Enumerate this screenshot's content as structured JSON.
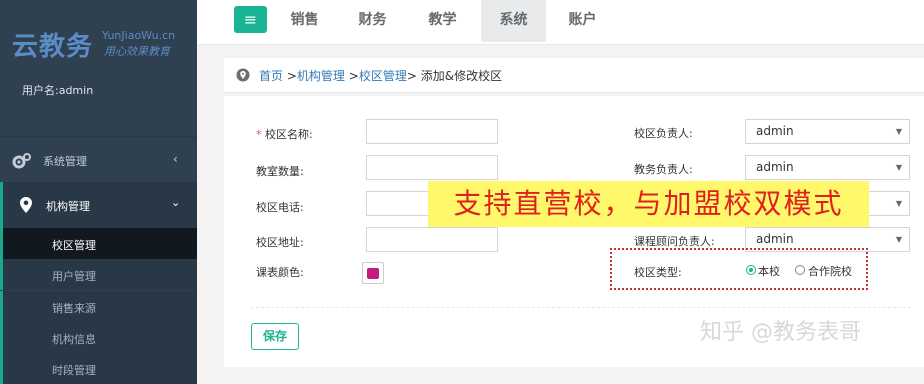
{
  "brand": {
    "name_cn": "云教务",
    "name_en": "YunJiaoWu.cn",
    "slogan": "用心效果教育"
  },
  "user": {
    "label": "用户名:admin"
  },
  "sidebar": {
    "system": {
      "label": "系统管理",
      "icon": "gears-icon"
    },
    "org": {
      "label": "机构管理",
      "icon": "map-marker-icon"
    },
    "sub_items": [
      "校区管理",
      "用户管理",
      "销售来源",
      "机构信息",
      "时段管理"
    ],
    "active_index": 0
  },
  "topnav": {
    "menu_glyph": "≡",
    "tabs": [
      "销售",
      "财务",
      "教学",
      "系统",
      "账户"
    ],
    "active_tab": "系统"
  },
  "breadcrumb": {
    "home": "首页",
    "level1": "机构管理",
    "level2": "校区管理",
    "current": "添加&修改校区",
    "sep": ">"
  },
  "form": {
    "left": {
      "name_label": "校区名称:",
      "classrooms_label": "教室数量:",
      "phone_label": "校区电话:",
      "address_label": "校区地址:",
      "color_label": "课表颜色:"
    },
    "right": {
      "head_label": "校区负责人:",
      "head_value": "admin",
      "academic_label": "教务负责人:",
      "academic_value": "admin",
      "consultant_label": "课程顾问负责人:",
      "consultant_value": "admin",
      "type_label": "校区类型:",
      "type_options": [
        "本校",
        "合作院校"
      ],
      "type_selected": "本校"
    },
    "required_mark": "*",
    "save_label": "保存"
  },
  "overlay": {
    "banner_text": "支持直营校，与加盟校双模式",
    "watermark": "知乎 @教务表哥"
  },
  "colors": {
    "accent": "#1ab394",
    "sidebar_bg": "#2f4050",
    "course_color": "#c21a7f",
    "banner_bg": "#fff86a",
    "banner_text": "#e02020"
  }
}
